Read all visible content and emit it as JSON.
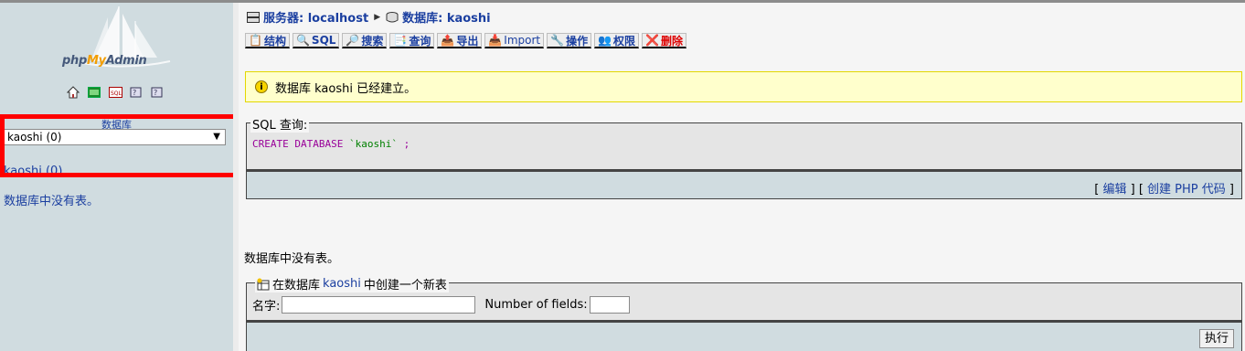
{
  "sidebar": {
    "logo_text_php": "php",
    "logo_text_my": "My",
    "logo_text_admin": "Admin",
    "db_label": "数据库",
    "db_selected": "kaoshi (0)",
    "db_link": "kaoshi (0)",
    "no_tables": "数据库中没有表。"
  },
  "breadcrumb": {
    "server": "服务器: localhost",
    "database": "数据库: kaoshi"
  },
  "tabs": [
    {
      "label": "结构"
    },
    {
      "label": "SQL"
    },
    {
      "label": "搜索"
    },
    {
      "label": "查询"
    },
    {
      "label": "导出"
    },
    {
      "label": "Import"
    },
    {
      "label": "操作"
    },
    {
      "label": "权限"
    },
    {
      "label": "删除"
    }
  ],
  "notice": {
    "icon_text": "i",
    "text": "数据库 kaoshi 已经建立。"
  },
  "sql": {
    "legend": "SQL 查询:",
    "keyword": "CREATE DATABASE",
    "name": "`kaoshi`",
    "terminator": ";",
    "bracket_open": "[",
    "edit_link": "编辑",
    "bracket_mid": "] [",
    "php_link": "创建 PHP 代码",
    "bracket_close": "]"
  },
  "main": {
    "no_tables": "数据库中没有表。"
  },
  "create": {
    "legend_prefix": "在数据库",
    "legend_db": "kaoshi",
    "legend_suffix": "中创建一个新表",
    "name_label": "名字:",
    "name_value": "",
    "fields_label": "Number of fields:",
    "fields_value": "",
    "exec_label": "执行"
  },
  "colors": {
    "sidebar_bg": "#d0dce0",
    "link": "#1b3fa0",
    "highlight_box": "#ff0000",
    "notice_bg": "#ffffcc"
  }
}
